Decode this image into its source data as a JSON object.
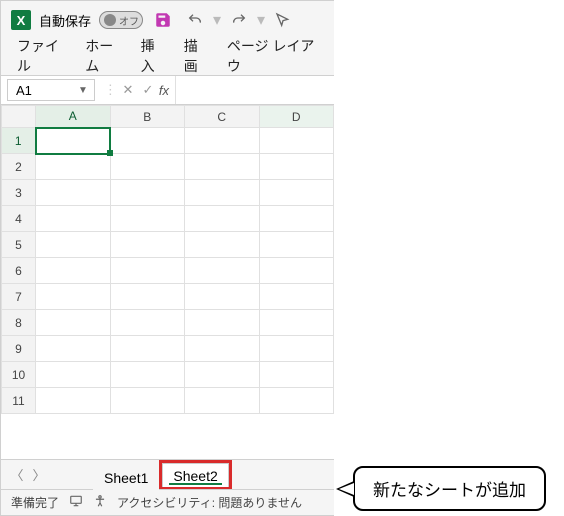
{
  "titlebar": {
    "app_initial": "X",
    "autosave_label": "自動保存",
    "autosave_state": "オフ"
  },
  "ribbon": {
    "tabs": [
      "ファイル",
      "ホーム",
      "挿入",
      "描画",
      "ページ レイアウ"
    ]
  },
  "formula_bar": {
    "namebox_value": "A1",
    "fx_label": "fx",
    "formula_value": ""
  },
  "grid": {
    "columns": [
      "A",
      "B",
      "C",
      "D"
    ],
    "rows": [
      "1",
      "2",
      "3",
      "4",
      "5",
      "6",
      "7",
      "8",
      "9",
      "10",
      "11"
    ],
    "selected_cell": "A1"
  },
  "sheet_tabs": {
    "tabs": [
      {
        "name": "Sheet1",
        "active": false
      },
      {
        "name": "Sheet2",
        "active": true
      }
    ]
  },
  "statusbar": {
    "ready": "準備完了",
    "accessibility": "アクセシビリティ: 問題ありません"
  },
  "callout": {
    "text": "新たなシートが追加"
  }
}
